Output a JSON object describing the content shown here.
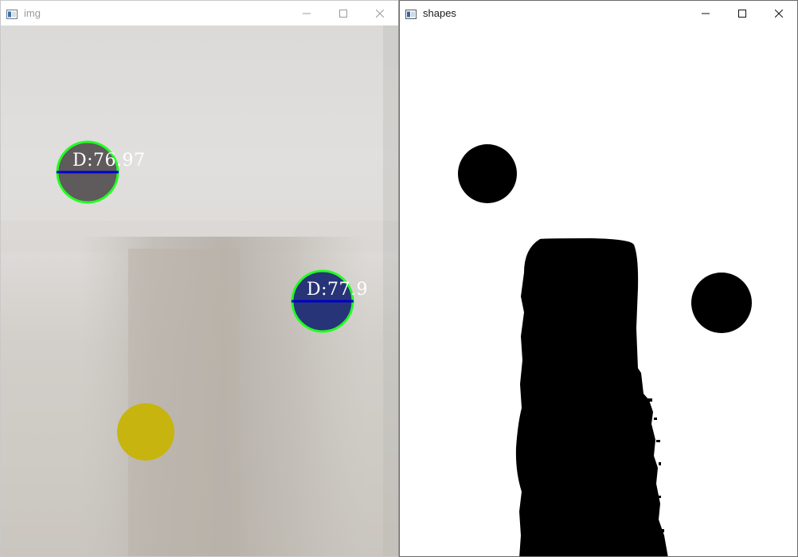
{
  "windows": [
    {
      "title": "img",
      "controls": [
        "minimize-icon",
        "maximize-icon",
        "close-icon"
      ],
      "measurements": [
        {
          "label": "D:76.97",
          "fill": "#5f5a5c"
        },
        {
          "label": "D:77.9",
          "fill": "#283478"
        }
      ],
      "unlabeled_disc": {
        "fill": "#c7b40f"
      }
    },
    {
      "title": "shapes",
      "controls": [
        "minimize-icon",
        "maximize-icon",
        "close-icon"
      ]
    }
  ],
  "colors": {
    "contour": "#22ff22",
    "diameter_line": "#0000cc",
    "label_text": "#ffffff",
    "mask_fg": "#000000",
    "mask_bg": "#ffffff"
  }
}
